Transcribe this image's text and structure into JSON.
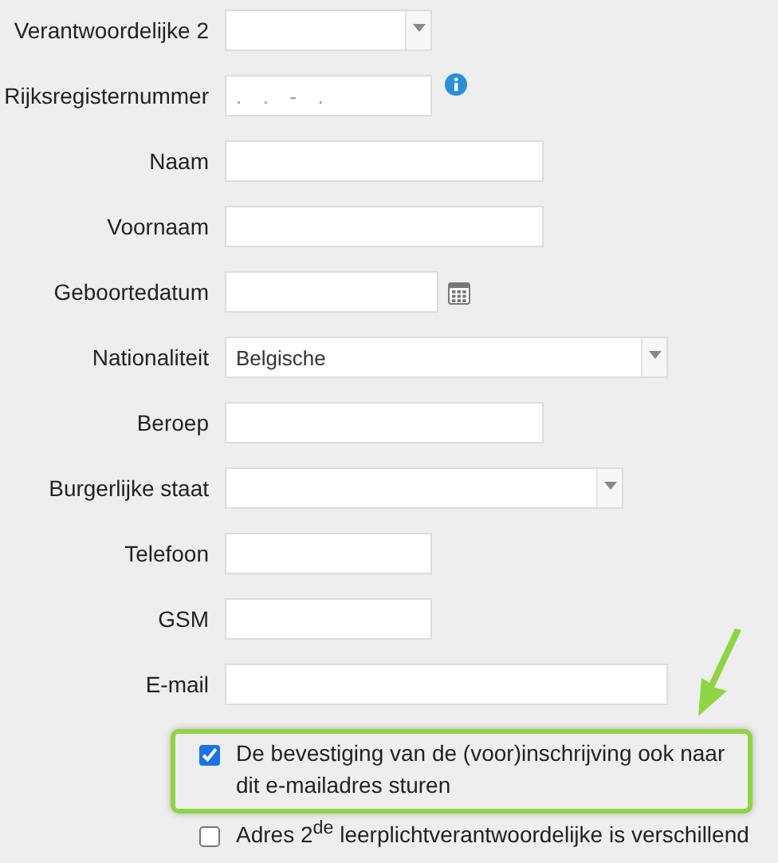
{
  "fields": [
    {
      "label": "Verantwoordelijke 2",
      "kind": "select"
    },
    {
      "label": "Rijksregisternummer",
      "kind": "masked",
      "placeholder": ".  .  -  ."
    },
    {
      "label": "Naam",
      "kind": "text"
    },
    {
      "label": "Voornaam",
      "kind": "text"
    },
    {
      "label": "Geboortedatum",
      "kind": "date"
    },
    {
      "label": "Nationaliteit",
      "kind": "select",
      "value": "Belgische"
    },
    {
      "label": "Beroep",
      "kind": "text"
    },
    {
      "label": "Burgerlijke staat",
      "kind": "select"
    },
    {
      "label": "Telefoon",
      "kind": "text"
    },
    {
      "label": "GSM",
      "kind": "text"
    },
    {
      "label": "E-mail",
      "kind": "text"
    }
  ],
  "checkboxes": [
    {
      "label": "De bevestiging van de (voor)inschrijving ook naar dit e-mailadres sturen",
      "checked": true,
      "highlighted": true
    },
    {
      "label": "Adres 2$^{de}$ leerplichtverantwoordelijke is verschillend",
      "checked": false,
      "highlighted": false
    }
  ]
}
